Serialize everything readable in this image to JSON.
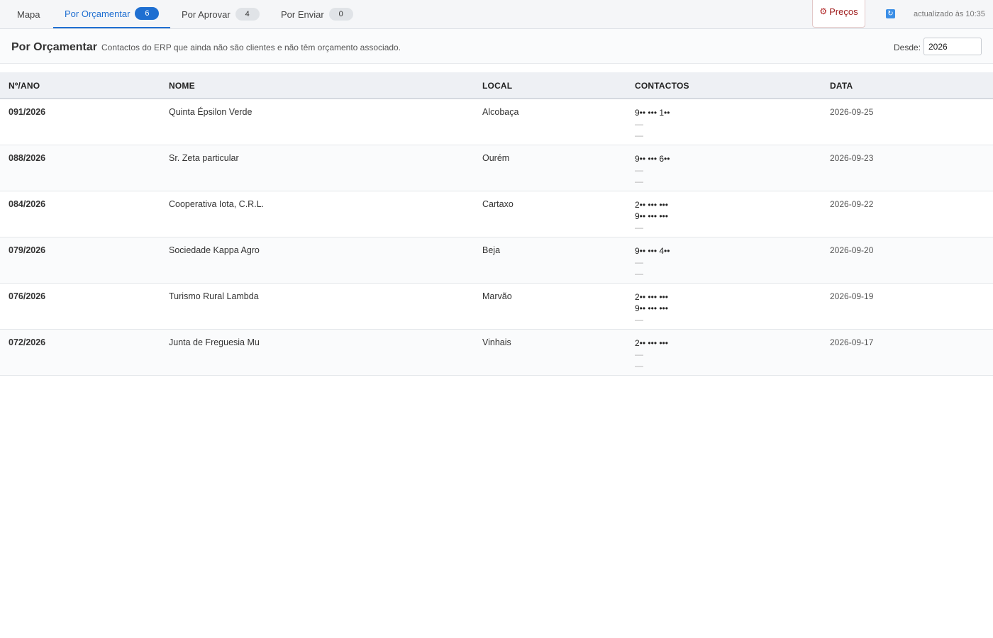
{
  "tabs": [
    {
      "label": "Mapa",
      "badge": null
    },
    {
      "label": "Por Orçamentar",
      "badge": "6"
    },
    {
      "label": "Por Aprovar",
      "badge": "4"
    },
    {
      "label": "Por Enviar",
      "badge": "0"
    }
  ],
  "topbar": {
    "precos_label": "Preços",
    "precos_icon": "gear-icon",
    "refresh_icon": "refresh-icon",
    "updated_text": "actualizado às 10:35",
    "accent_color": "#1f6fd1",
    "precos_color": "#a02020"
  },
  "header": {
    "title": "Por Orçamentar",
    "description": "Contactos do ERP que ainda não são clientes e não têm orçamento associado.",
    "desde_label": "Desde:",
    "desde_value": "2026"
  },
  "table": {
    "columns": [
      "Nº/ANO",
      "NOME",
      "LOCAL",
      "CONTACTOS",
      "DATA"
    ],
    "rows": [
      {
        "num": "091/2026",
        "nome": "Quinta Épsilon Verde",
        "local": "Alcobaça",
        "contacts": [
          "9•• ••• 1••",
          "—",
          "—"
        ],
        "data": "2026-09-25"
      },
      {
        "num": "088/2026",
        "nome": "Sr. Zeta particular",
        "local": "Ourém",
        "contacts": [
          "9•• ••• 6••",
          "—",
          "—"
        ],
        "data": "2026-09-23"
      },
      {
        "num": "084/2026",
        "nome": "Cooperativa Iota, C.R.L.",
        "local": "Cartaxo",
        "contacts": [
          "2•• ••• •••",
          "9•• ••• •••",
          "—"
        ],
        "data": "2026-09-22"
      },
      {
        "num": "079/2026",
        "nome": "Sociedade Kappa Agro",
        "local": "Beja",
        "contacts": [
          "9•• ••• 4••",
          "—",
          "—"
        ],
        "data": "2026-09-20"
      },
      {
        "num": "076/2026",
        "nome": "Turismo Rural Lambda",
        "local": "Marvão",
        "contacts": [
          "2•• ••• •••",
          "9•• ••• •••",
          "—"
        ],
        "data": "2026-09-19"
      },
      {
        "num": "072/2026",
        "nome": "Junta de Freguesia Mu",
        "local": "Vinhais",
        "contacts": [
          "2•• ••• •••",
          "—",
          "—"
        ],
        "data": "2026-09-17"
      }
    ]
  }
}
